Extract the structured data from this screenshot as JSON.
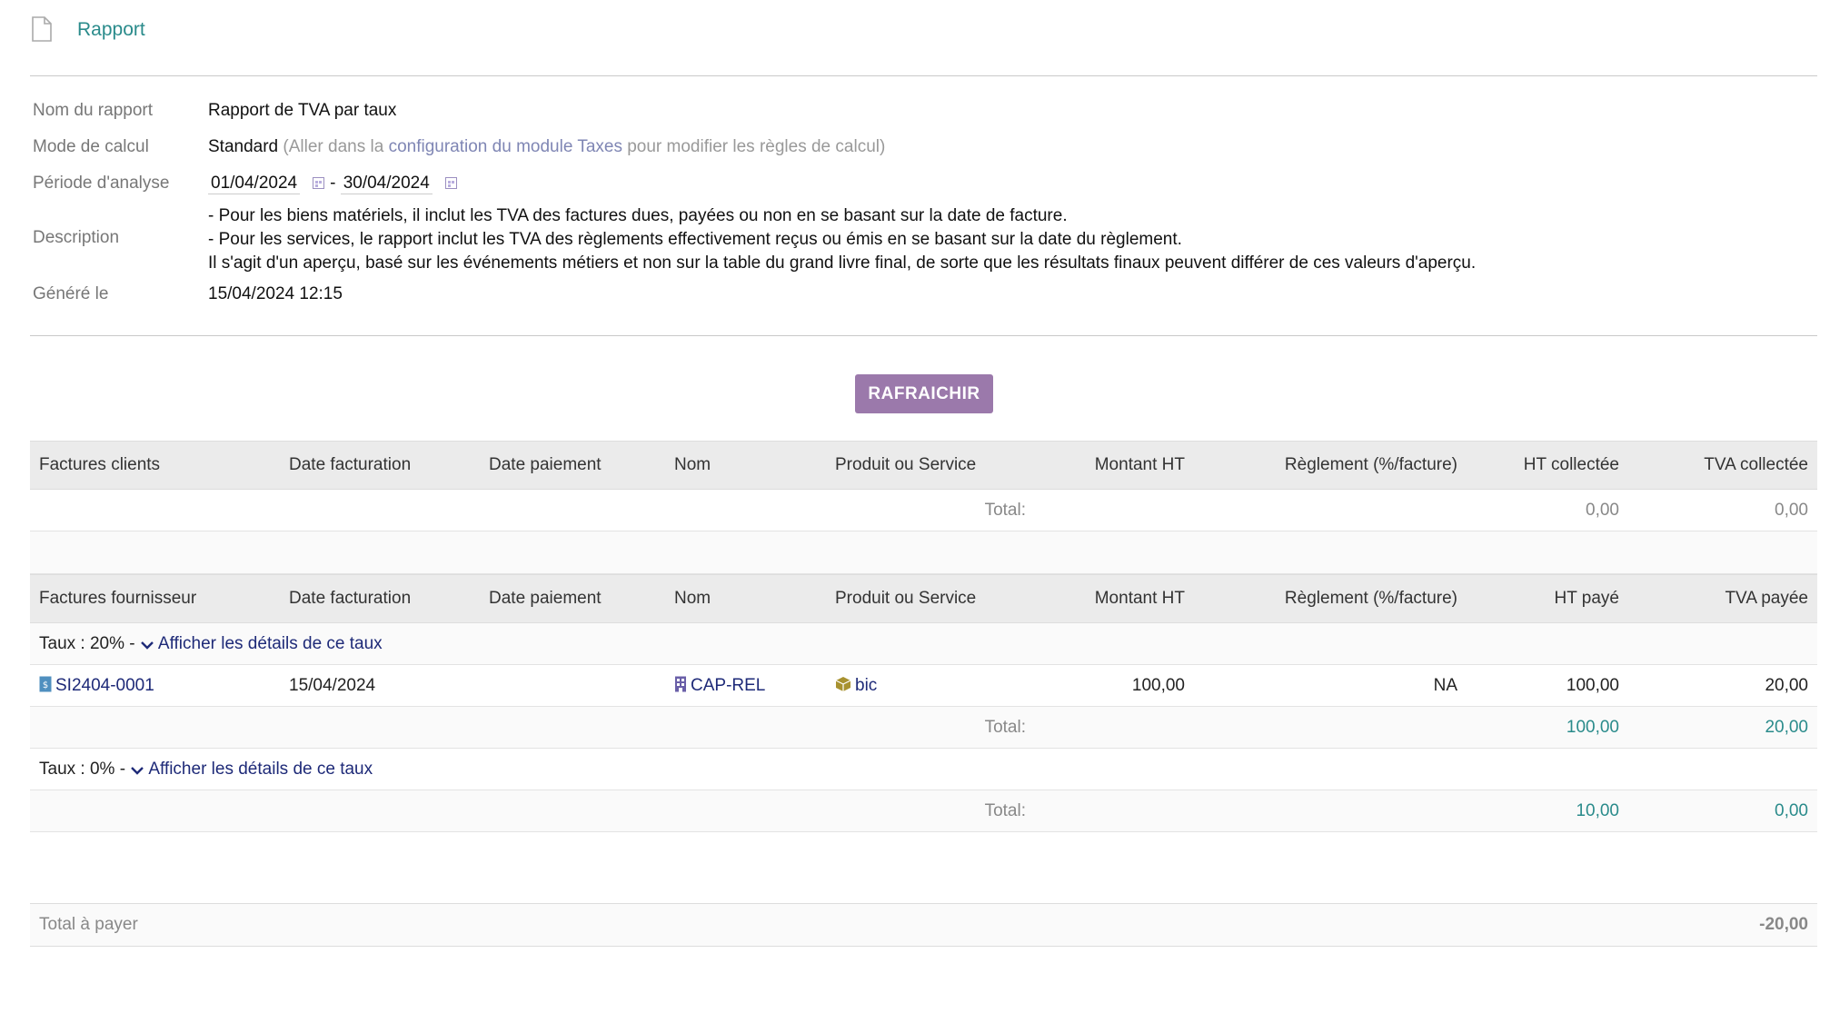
{
  "tab": {
    "label": "Rapport",
    "icon": "file-icon"
  },
  "info": {
    "nom_label": "Nom du rapport",
    "nom_value": "Rapport de TVA par taux",
    "mode_label": "Mode de calcul",
    "mode_value": "Standard",
    "mode_hint_pre": "(Aller dans la ",
    "mode_hint_link": "configuration du module Taxes",
    "mode_hint_post": " pour modifier les règles de calcul)",
    "periode_label": "Période d'analyse",
    "date_from": "01/04/2024",
    "date_sep": "-",
    "date_to": "30/04/2024",
    "desc_label": "Description",
    "desc_lines": [
      "- Pour les biens matériels, il inclut les TVA des factures dues, payées ou non en se basant sur la date de facture.",
      "- Pour les services, le rapport inclut les TVA des règlements effectivement reçus ou émis en se basant sur la date du règlement.",
      "Il s'agit d'un aperçu, basé sur les événements métiers et non sur la table du grand livre final, de sorte que les résultats finaux peuvent différer de ces valeurs d'aperçu."
    ],
    "genere_label": "Généré le",
    "genere_value": "15/04/2024 12:15"
  },
  "refresh_button": "RAFRAICHIR",
  "clients": {
    "headers": [
      "Factures clients",
      "Date facturation",
      "Date paiement",
      "Nom",
      "Produit ou Service",
      "Montant HT",
      "Règlement (%/facture)",
      "HT collectée",
      "TVA collectée"
    ],
    "total_label": "Total:",
    "total_ht": "0,00",
    "total_tva": "0,00"
  },
  "fournisseurs": {
    "headers": [
      "Factures fournisseur",
      "Date facturation",
      "Date paiement",
      "Nom",
      "Produit ou Service",
      "Montant HT",
      "Règlement (%/facture)",
      "HT payé",
      "TVA payée"
    ],
    "groups": [
      {
        "taux_label": "Taux : 20% - ",
        "details_link": "Afficher les détails de ce taux",
        "rows": [
          {
            "ref": "SI2404-0001",
            "date_fact": "15/04/2024",
            "date_pay": "",
            "nom": "CAP-REL",
            "produit": "bic",
            "montant": "100,00",
            "reglement": "NA",
            "ht": "100,00",
            "tva": "20,00"
          }
        ],
        "total_label": "Total:",
        "total_ht": "100,00",
        "total_tva": "20,00"
      },
      {
        "taux_label": "Taux : 0% - ",
        "details_link": "Afficher les détails de ce taux",
        "rows": [],
        "total_label": "Total:",
        "total_ht": "10,00",
        "total_tva": "0,00"
      }
    ]
  },
  "total_a_payer": {
    "label": "Total à payer",
    "value": "-20,00"
  },
  "colors": {
    "accent": "#2a8b8b",
    "button": "#9b79ab",
    "link": "#1e2a78"
  }
}
